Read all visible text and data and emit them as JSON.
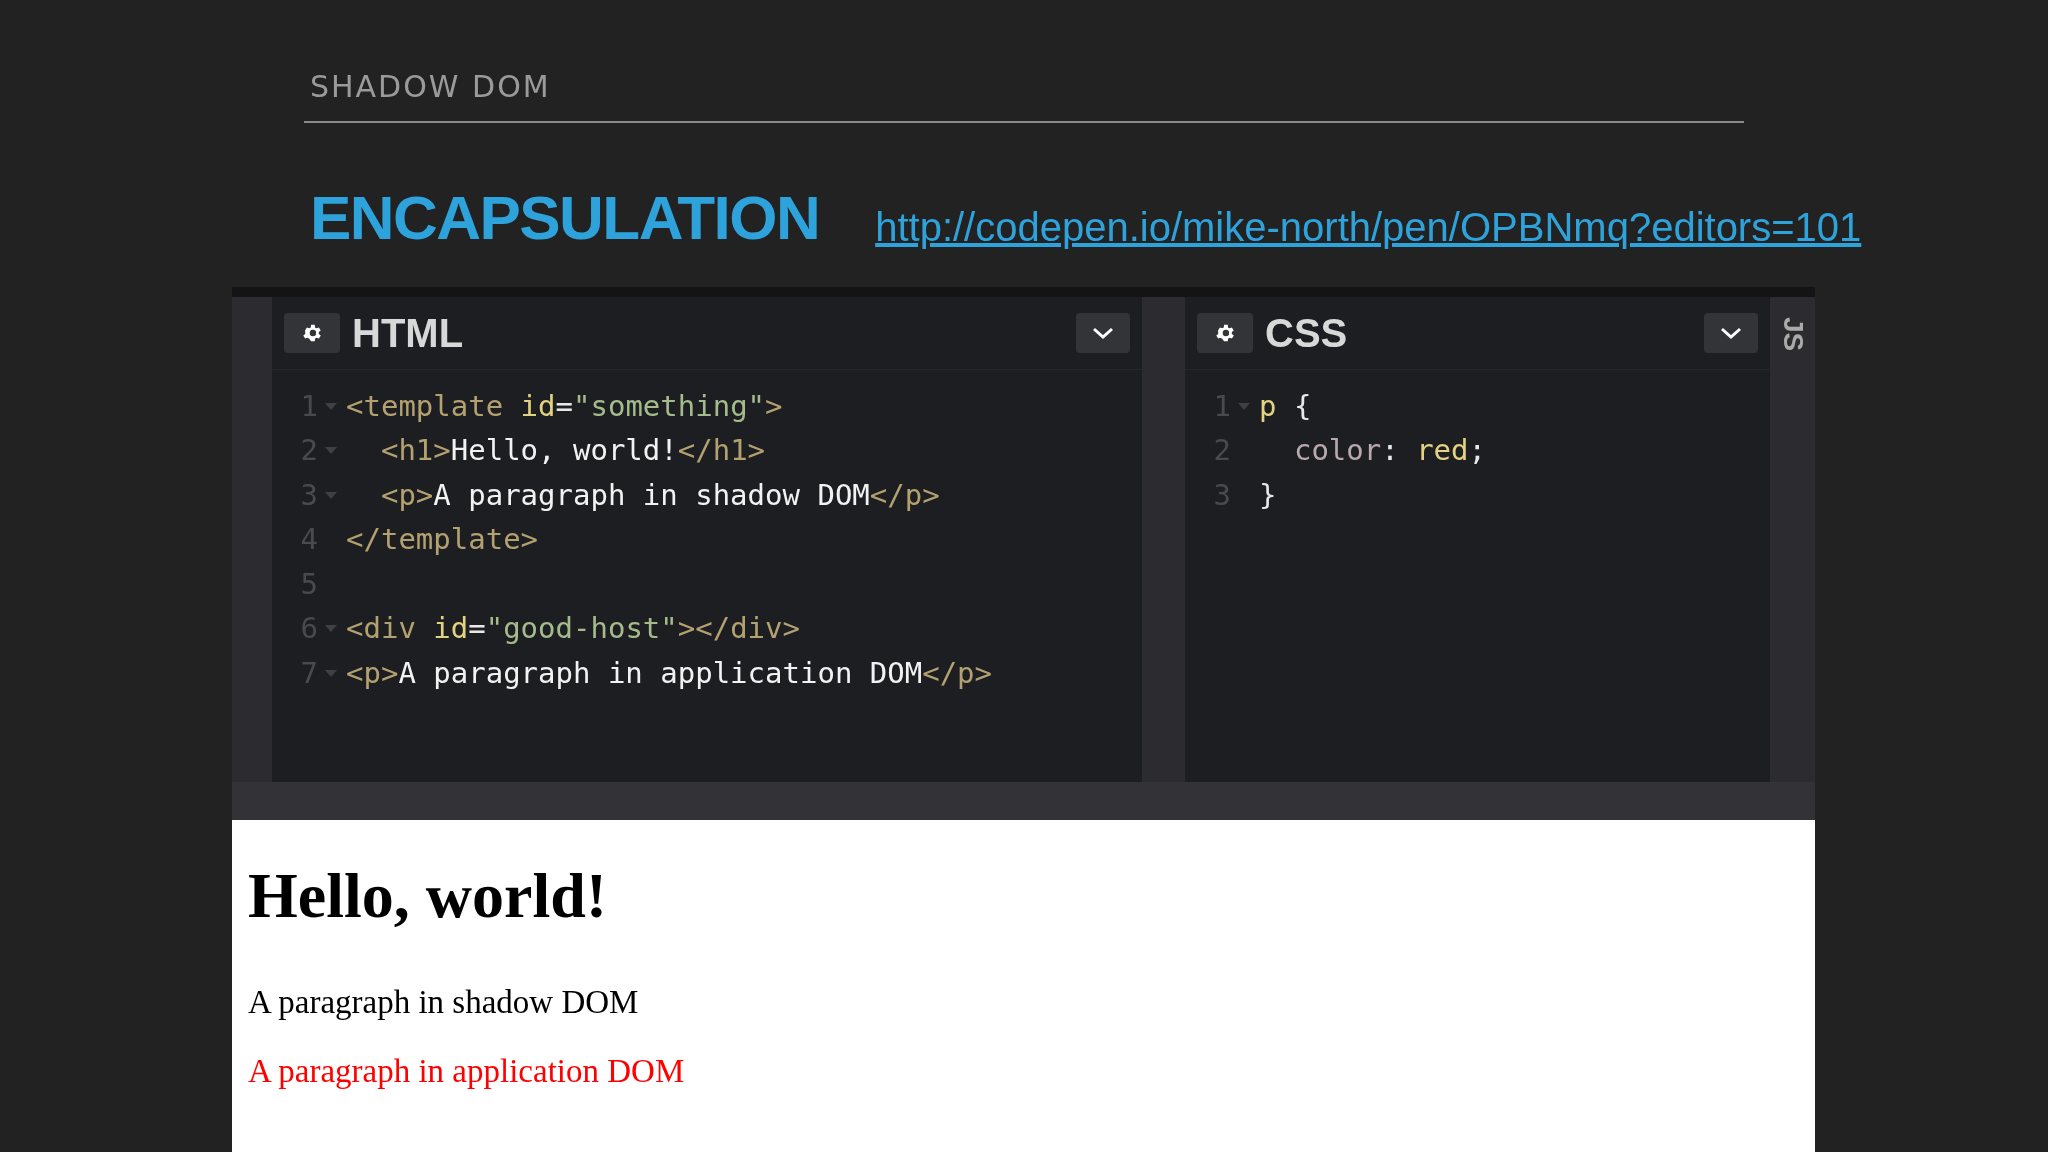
{
  "slide": {
    "section_title": "SHADOW DOM",
    "title": "ENCAPSULATION",
    "link": "http://codepen.io/mike-north/pen/OPBNmq?editors=101"
  },
  "editors": [
    {
      "title": "HTML",
      "lines": [
        {
          "number": "1",
          "foldable": true,
          "tokens": [
            {
              "kind": "tag",
              "text": "<template "
            },
            {
              "kind": "attr",
              "text": "id"
            },
            {
              "kind": "punct",
              "text": "="
            },
            {
              "kind": "string",
              "text": "\"something\""
            },
            {
              "kind": "tag",
              "text": ">"
            }
          ]
        },
        {
          "number": "2",
          "foldable": true,
          "tokens": [
            {
              "kind": "tag",
              "text": "  <h1>"
            },
            {
              "kind": "text",
              "text": "Hello, world!"
            },
            {
              "kind": "tag",
              "text": "</h1>"
            }
          ]
        },
        {
          "number": "3",
          "foldable": true,
          "tokens": [
            {
              "kind": "tag",
              "text": "  <p>"
            },
            {
              "kind": "text",
              "text": "A paragraph in shadow DOM"
            },
            {
              "kind": "tag",
              "text": "</p>"
            }
          ]
        },
        {
          "number": "4",
          "foldable": false,
          "tokens": [
            {
              "kind": "tag",
              "text": "</template>"
            }
          ]
        },
        {
          "number": "5",
          "foldable": false
        },
        {
          "number": "6",
          "foldable": true,
          "tokens": [
            {
              "kind": "tag",
              "text": "<div "
            },
            {
              "kind": "attr",
              "text": "id"
            },
            {
              "kind": "punct",
              "text": "="
            },
            {
              "kind": "string",
              "text": "\"good-host\""
            },
            {
              "kind": "tag",
              "text": "></div>"
            }
          ]
        },
        {
          "number": "7",
          "foldable": true,
          "tokens": [
            {
              "kind": "tag",
              "text": "<p>"
            },
            {
              "kind": "text",
              "text": "A paragraph in application DOM"
            },
            {
              "kind": "tag",
              "text": "</p>"
            }
          ]
        }
      ]
    },
    {
      "title": "CSS",
      "lines": [
        {
          "number": "1",
          "foldable": true,
          "tokens": [
            {
              "kind": "attr",
              "text": "p"
            },
            {
              "kind": "punct",
              "text": " {"
            }
          ]
        },
        {
          "number": "2",
          "foldable": false,
          "tokens": [
            {
              "kind": "property",
              "text": "  color"
            },
            {
              "kind": "punct",
              "text": ": "
            },
            {
              "kind": "attr",
              "text": "red"
            },
            {
              "kind": "punct",
              "text": ";"
            }
          ]
        },
        {
          "number": "3",
          "foldable": false,
          "tokens": [
            {
              "kind": "punct",
              "text": "}"
            }
          ]
        }
      ]
    }
  ],
  "js_tab": "JS",
  "output": {
    "heading": "Hello, world!",
    "paragraphs": [
      {
        "text": "A paragraph in shadow DOM",
        "color": "#000000"
      },
      {
        "text": "A paragraph in application DOM",
        "color": "#ff0000"
      }
    ]
  }
}
